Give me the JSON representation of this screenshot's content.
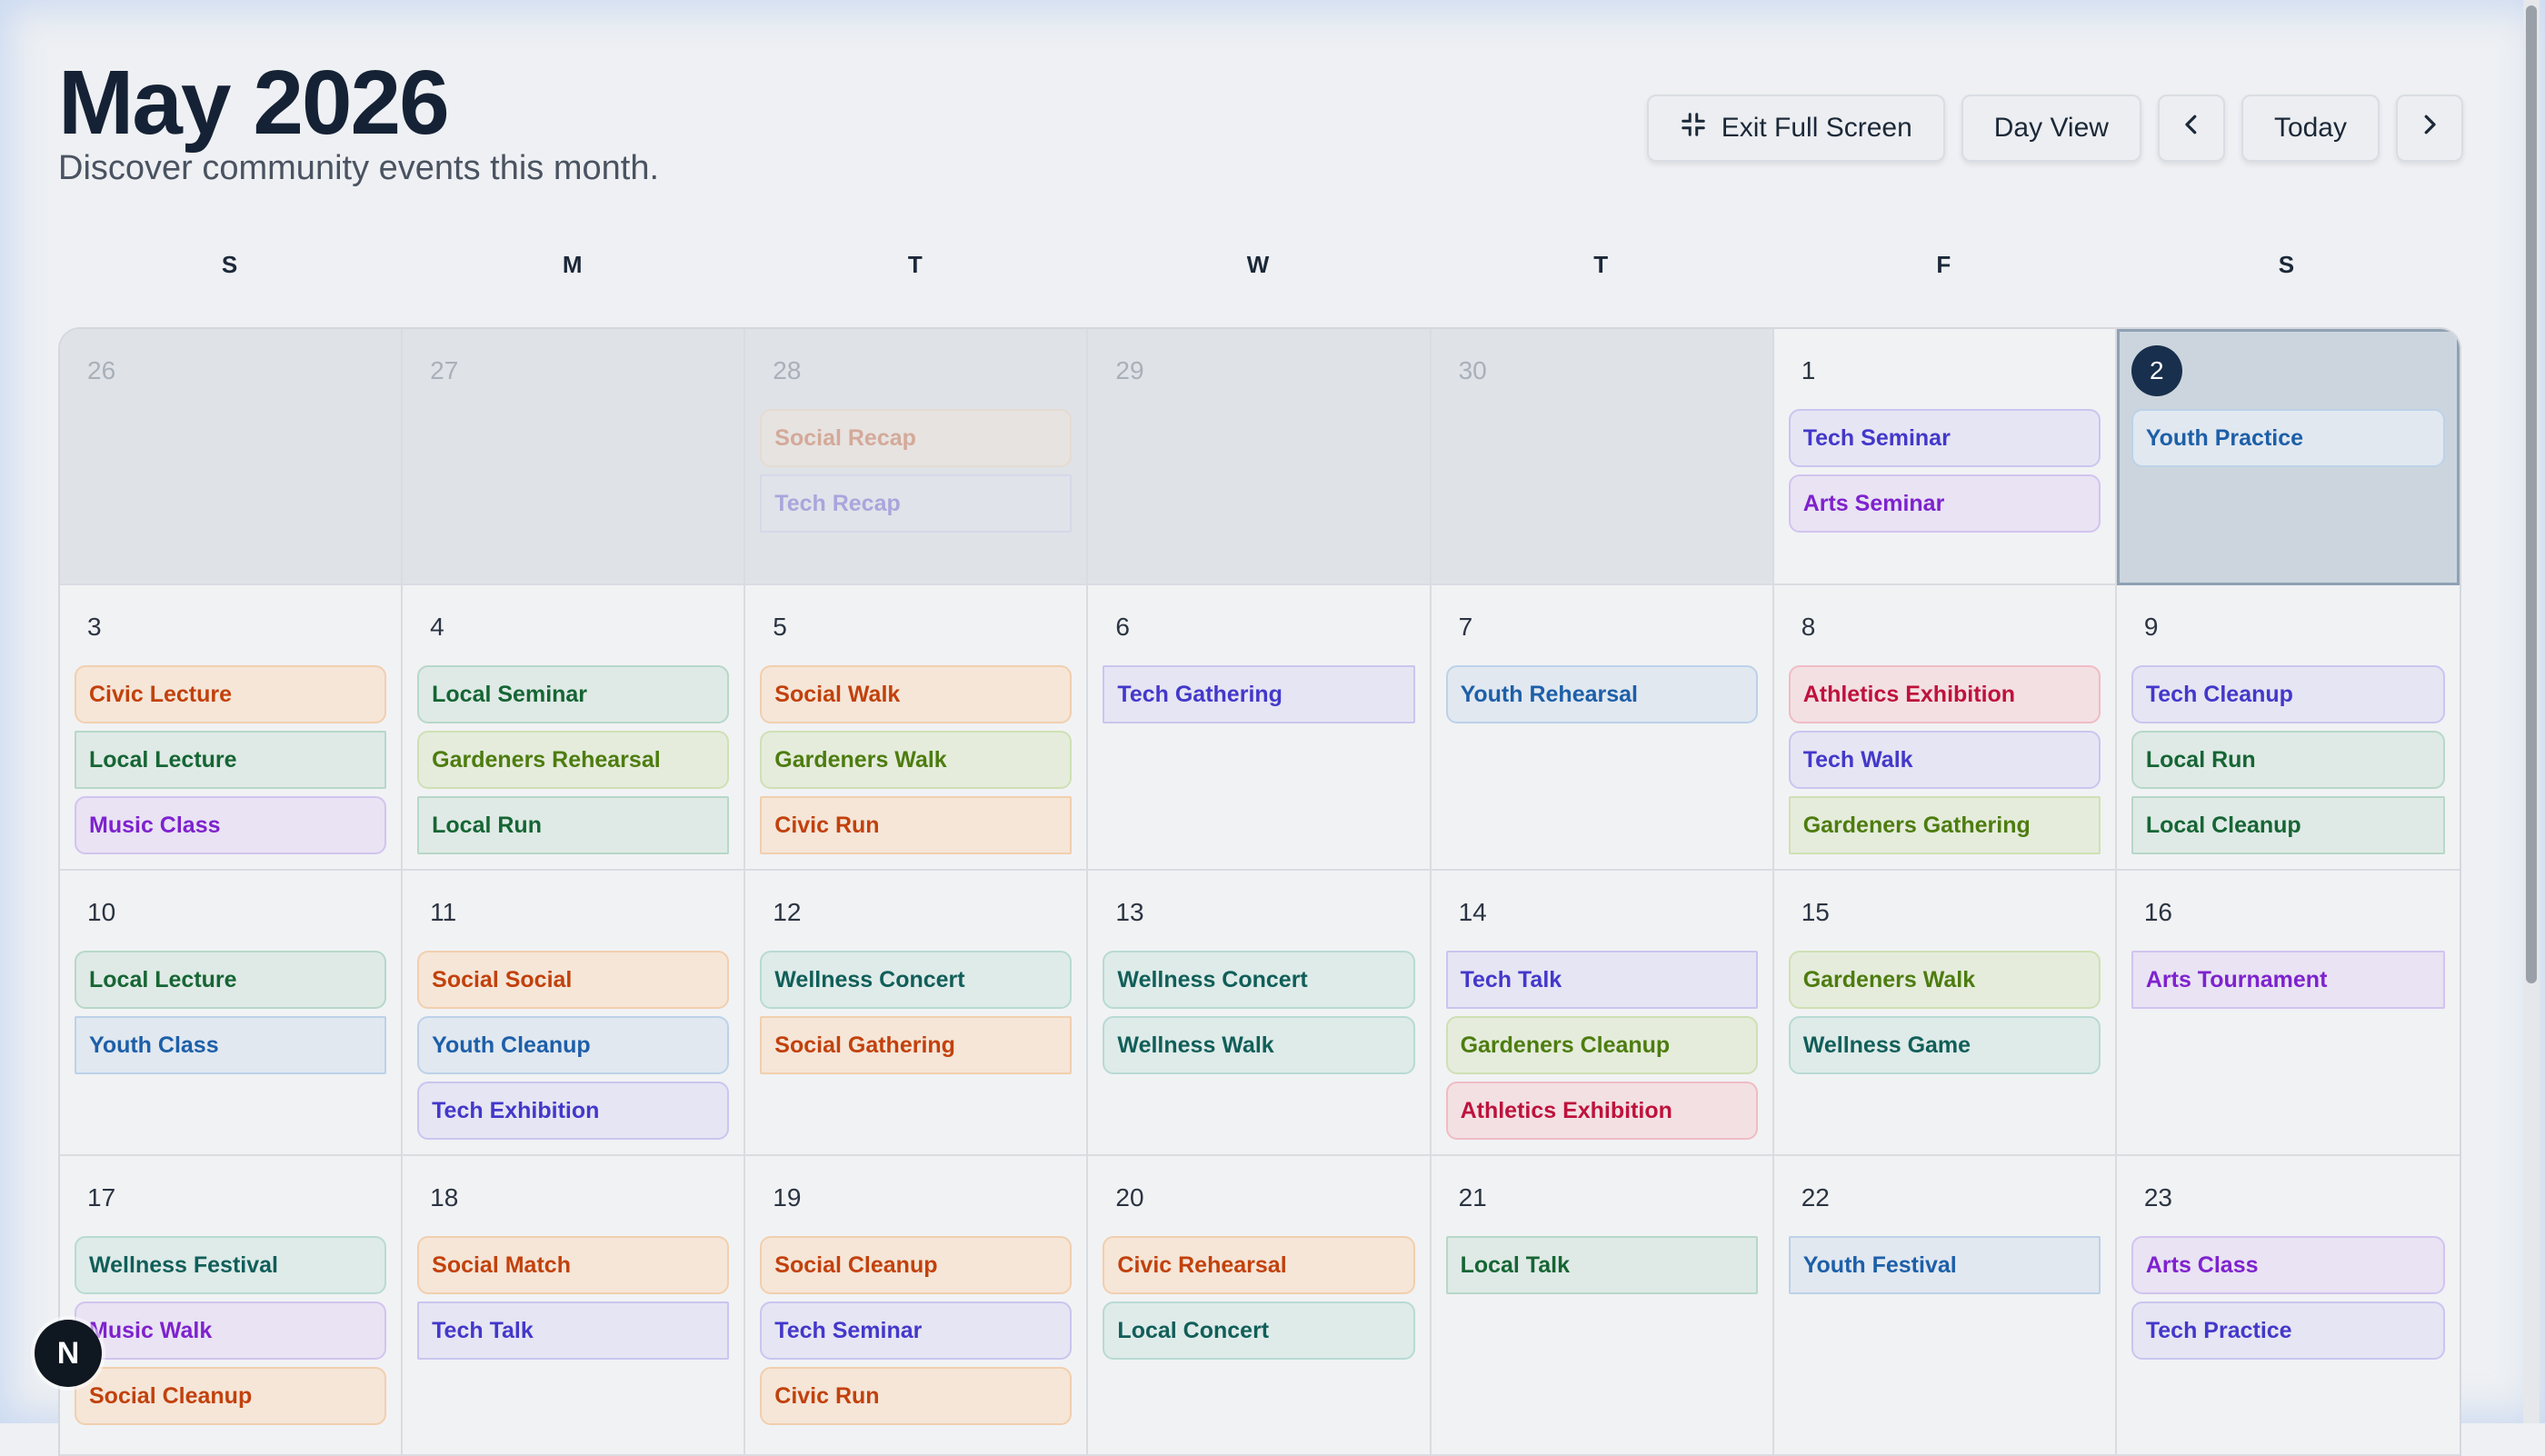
{
  "header": {
    "title": "May 2026",
    "subtitle": "Discover community events this month."
  },
  "toolbar": {
    "exit_fullscreen_label": "Exit Full Screen",
    "day_view_label": "Day View",
    "today_label": "Today",
    "prev_icon": "chevron-left-icon",
    "next_icon": "chevron-right-icon",
    "exit_icon": "exit-fullscreen-icon"
  },
  "weekdays": [
    "S",
    "M",
    "T",
    "W",
    "T",
    "F",
    "S"
  ],
  "colors": {
    "today_badge": "#18304d",
    "orange": "#c2410c",
    "green": "#166534",
    "purple": "#7e22ce",
    "indigo": "#4338ca",
    "blue": "#1d5fa8",
    "lime": "#4d7c0f",
    "teal": "#115e59",
    "red": "#be123c"
  },
  "weeks": [
    [
      {
        "day": "26",
        "muted": true,
        "events": []
      },
      {
        "day": "27",
        "muted": true,
        "events": []
      },
      {
        "day": "28",
        "muted": true,
        "events": [
          {
            "title": "Social Recap",
            "color": "orange"
          },
          {
            "title": "Tech Recap",
            "color": "indigo",
            "square": true
          }
        ]
      },
      {
        "day": "29",
        "muted": true,
        "events": []
      },
      {
        "day": "30",
        "muted": true,
        "events": []
      },
      {
        "day": "1",
        "events": [
          {
            "title": "Tech Seminar",
            "color": "indigo"
          },
          {
            "title": "Arts Seminar",
            "color": "purple"
          }
        ]
      },
      {
        "day": "2",
        "today": true,
        "selected": true,
        "events": [
          {
            "title": "Youth Practice",
            "color": "blue"
          }
        ]
      }
    ],
    [
      {
        "day": "3",
        "events": [
          {
            "title": "Civic Lecture",
            "color": "orange"
          },
          {
            "title": "Local Lecture",
            "color": "green",
            "square": true
          },
          {
            "title": "Music Class",
            "color": "purple"
          }
        ]
      },
      {
        "day": "4",
        "events": [
          {
            "title": "Local Seminar",
            "color": "green"
          },
          {
            "title": "Gardeners Rehearsal",
            "color": "lime"
          },
          {
            "title": "Local Run",
            "color": "green",
            "square": true
          }
        ]
      },
      {
        "day": "5",
        "events": [
          {
            "title": "Social Walk",
            "color": "orange"
          },
          {
            "title": "Gardeners Walk",
            "color": "lime"
          },
          {
            "title": "Civic Run",
            "color": "orange",
            "square": true
          }
        ]
      },
      {
        "day": "6",
        "events": [
          {
            "title": "Tech Gathering",
            "color": "indigo",
            "square": true
          }
        ]
      },
      {
        "day": "7",
        "events": [
          {
            "title": "Youth Rehearsal",
            "color": "blue"
          }
        ]
      },
      {
        "day": "8",
        "events": [
          {
            "title": "Athletics Exhibition",
            "color": "red"
          },
          {
            "title": "Tech Walk",
            "color": "indigo"
          },
          {
            "title": "Gardeners Gathering",
            "color": "lime",
            "square": true
          }
        ]
      },
      {
        "day": "9",
        "events": [
          {
            "title": "Tech Cleanup",
            "color": "indigo"
          },
          {
            "title": "Local Run",
            "color": "green"
          },
          {
            "title": "Local Cleanup",
            "color": "green",
            "square": true
          }
        ]
      }
    ],
    [
      {
        "day": "10",
        "events": [
          {
            "title": "Local Lecture",
            "color": "green"
          },
          {
            "title": "Youth Class",
            "color": "blue",
            "square": true
          }
        ]
      },
      {
        "day": "11",
        "events": [
          {
            "title": "Social Social",
            "color": "orange"
          },
          {
            "title": "Youth Cleanup",
            "color": "blue"
          },
          {
            "title": "Tech Exhibition",
            "color": "indigo"
          }
        ]
      },
      {
        "day": "12",
        "events": [
          {
            "title": "Wellness Concert",
            "color": "teal"
          },
          {
            "title": "Social Gathering",
            "color": "orange",
            "square": true
          }
        ]
      },
      {
        "day": "13",
        "events": [
          {
            "title": "Wellness Concert",
            "color": "teal"
          },
          {
            "title": "Wellness Walk",
            "color": "teal"
          }
        ]
      },
      {
        "day": "14",
        "events": [
          {
            "title": "Tech Talk",
            "color": "indigo",
            "square": true
          },
          {
            "title": "Gardeners Cleanup",
            "color": "lime"
          },
          {
            "title": "Athletics Exhibition",
            "color": "red"
          }
        ]
      },
      {
        "day": "15",
        "events": [
          {
            "title": "Gardeners Walk",
            "color": "lime"
          },
          {
            "title": "Wellness Game",
            "color": "teal"
          }
        ]
      },
      {
        "day": "16",
        "events": [
          {
            "title": "Arts Tournament",
            "color": "purple",
            "square": true
          }
        ]
      }
    ],
    [
      {
        "day": "17",
        "events": [
          {
            "title": "Wellness Festival",
            "color": "teal"
          },
          {
            "title": "Music Walk",
            "color": "purple"
          },
          {
            "title": "Social Cleanup",
            "color": "orange"
          }
        ]
      },
      {
        "day": "18",
        "events": [
          {
            "title": "Social Match",
            "color": "orange"
          },
          {
            "title": "Tech Talk",
            "color": "indigo",
            "square": true
          }
        ]
      },
      {
        "day": "19",
        "events": [
          {
            "title": "Social Cleanup",
            "color": "orange"
          },
          {
            "title": "Tech Seminar",
            "color": "indigo"
          },
          {
            "title": "Civic Run",
            "color": "orange"
          }
        ]
      },
      {
        "day": "20",
        "events": [
          {
            "title": "Civic Rehearsal",
            "color": "orange"
          },
          {
            "title": "Local Concert",
            "color": "teal"
          }
        ]
      },
      {
        "day": "21",
        "events": [
          {
            "title": "Local Talk",
            "color": "green",
            "square": true
          }
        ]
      },
      {
        "day": "22",
        "events": [
          {
            "title": "Youth Festival",
            "color": "blue",
            "square": true
          }
        ]
      },
      {
        "day": "23",
        "events": [
          {
            "title": "Arts Class",
            "color": "purple"
          },
          {
            "title": "Tech Practice",
            "color": "indigo"
          }
        ]
      }
    ]
  ],
  "badge": {
    "letter": "N"
  }
}
